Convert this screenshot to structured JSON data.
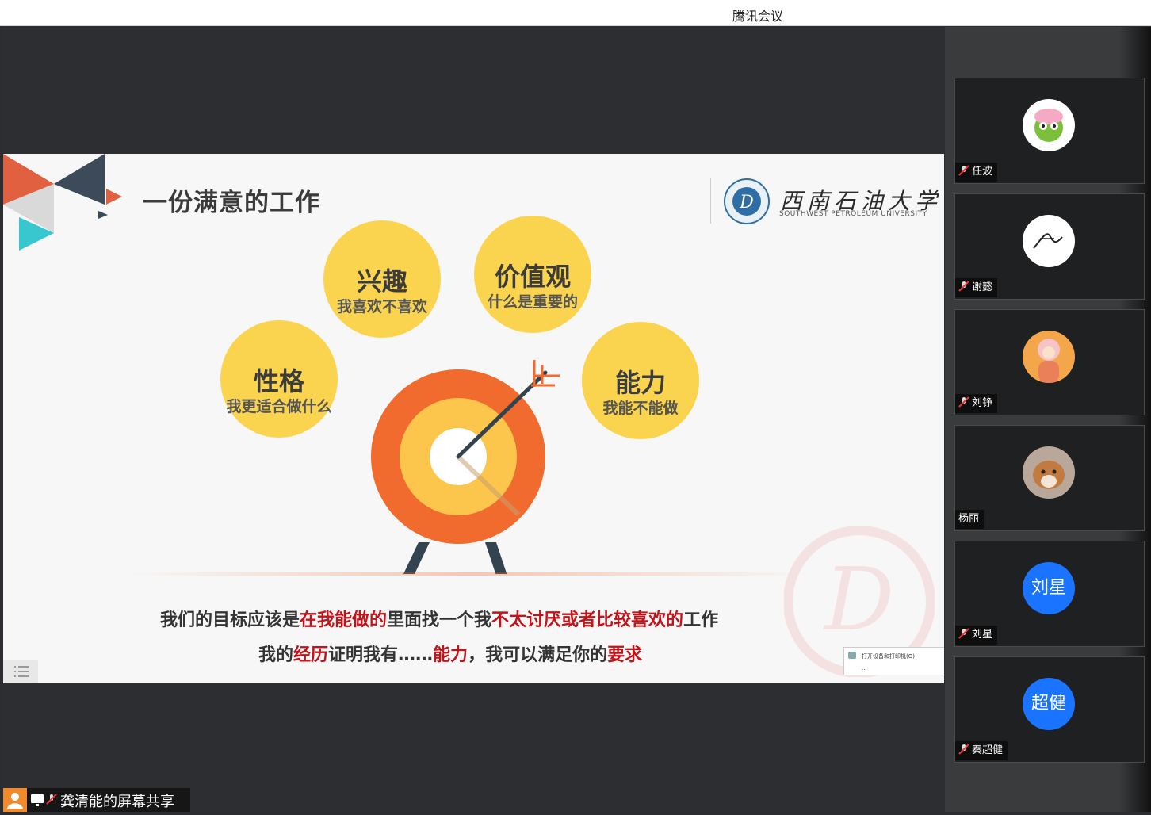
{
  "window": {
    "title": "腾讯会议"
  },
  "slide": {
    "title": "一份满意的工作",
    "university": {
      "name": "西南石油大学",
      "subtitle": "SOUTHWEST PETROLEUM UNIVERSITY"
    },
    "bubbles": [
      {
        "title": "兴趣",
        "subtitle": "我喜欢不喜欢"
      },
      {
        "title": "价值观",
        "subtitle": "什么是重要的"
      },
      {
        "title": "性格",
        "subtitle": "我更适合做什么"
      },
      {
        "title": "能力",
        "subtitle": "我能不能做"
      }
    ],
    "line1": [
      {
        "text": "我们的目标应该是",
        "red": false
      },
      {
        "text": "在我能做的",
        "red": true
      },
      {
        "text": "里面找一个我",
        "red": false
      },
      {
        "text": "不太讨厌或者比较喜欢的",
        "red": true
      },
      {
        "text": "工作",
        "red": false
      }
    ],
    "line2": [
      {
        "text": "我的",
        "red": false
      },
      {
        "text": "经历",
        "red": true
      },
      {
        "text": "证明我有……",
        "red": false
      },
      {
        "text": "能力",
        "red": true
      },
      {
        "text": "，我可以满足你的",
        "red": false
      },
      {
        "text": "要求",
        "red": true
      }
    ],
    "popup": {
      "item": "打开设备和打印机(O)",
      "more": "..."
    }
  },
  "participants": [
    {
      "name": "任波",
      "avatar": "cartoon-avatar",
      "muted": true
    },
    {
      "name": "谢懿",
      "avatar": "signature-avatar",
      "muted": true
    },
    {
      "name": "刘铮",
      "avatar": "illustration-avatar",
      "muted": true
    },
    {
      "name": "杨丽",
      "avatar": "pet-photo-avatar",
      "muted": false
    },
    {
      "name": "刘星",
      "avatar_text": "刘星",
      "muted": true
    },
    {
      "name": "秦超健",
      "avatar_text": "超健",
      "muted": true
    }
  ],
  "share_bar": {
    "label": "龚清能的屏幕共享"
  },
  "colors": {
    "accent_blue": "#1b74ff",
    "bubble_yellow": "#fbd44f",
    "target_orange": "#f26b2e",
    "highlight_red": "#c0141a"
  }
}
